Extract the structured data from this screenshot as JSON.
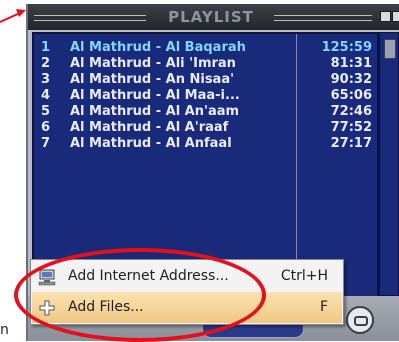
{
  "window": {
    "title": "PLAYLIST"
  },
  "playlist": [
    {
      "num": "1",
      "title": "Al Mathrud - Al Baqarah",
      "duration": "125:59",
      "selected": true
    },
    {
      "num": "2",
      "title": "Al Mathrud - Ali 'Imran",
      "duration": "81:31",
      "selected": false
    },
    {
      "num": "3",
      "title": "Al Mathrud - An Nisaa'",
      "duration": "90:32",
      "selected": false
    },
    {
      "num": "4",
      "title": "Al Mathrud - Al Maa-i...",
      "duration": "65:06",
      "selected": false
    },
    {
      "num": "5",
      "title": "Al Mathrud - Al An'aam",
      "duration": "72:46",
      "selected": false
    },
    {
      "num": "6",
      "title": "Al Mathrud - Al A'raaf",
      "duration": "77:52",
      "selected": false
    },
    {
      "num": "7",
      "title": "Al Mathrud - Al Anfaal",
      "duration": "27:17",
      "selected": false
    }
  ],
  "context_menu": {
    "items": [
      {
        "label": "Add Internet Address...",
        "shortcut": "Ctrl+H",
        "icon": "network-icon",
        "highlighted": false
      },
      {
        "label": "Add Files...",
        "shortcut": "F",
        "icon": "plus-icon",
        "highlighted": true
      }
    ]
  },
  "bottom_text": "n",
  "colors": {
    "list_background": "#1a2a7a",
    "list_text": "#e8ecff",
    "annotation_red": "#e4101a",
    "menu_highlight": "#f0c884"
  }
}
